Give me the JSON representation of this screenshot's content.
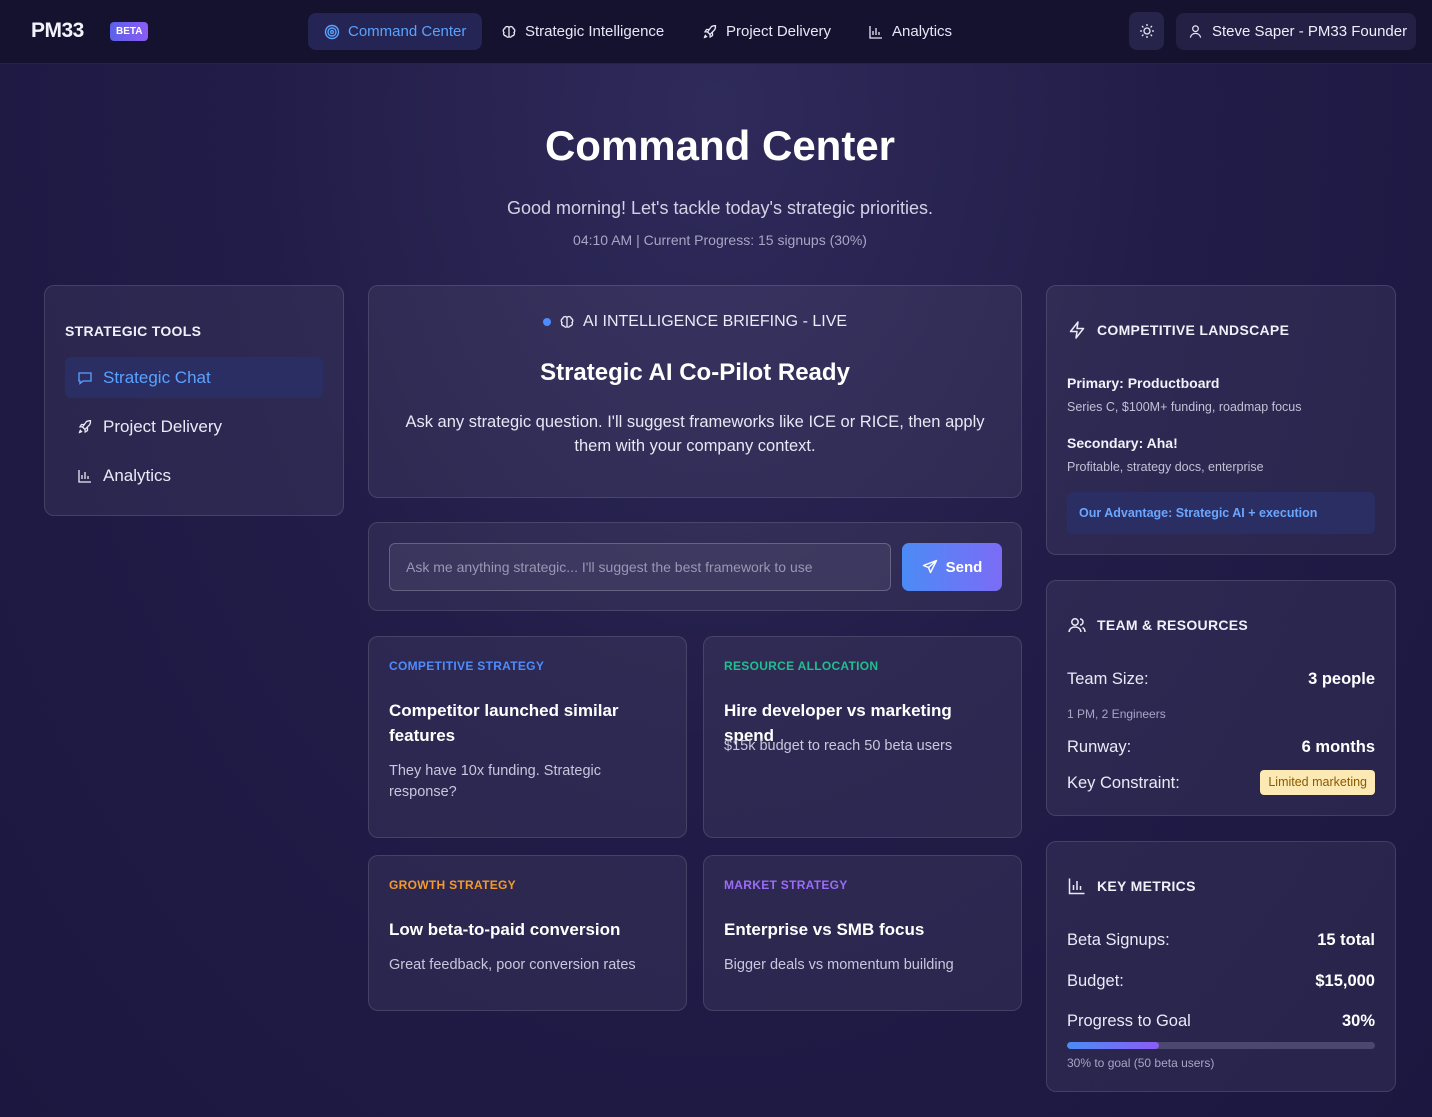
{
  "nav": {
    "logo": "PM33",
    "beta_badge": "BETA",
    "items": [
      {
        "label": "Command Center",
        "icon": "target-icon",
        "active": true
      },
      {
        "label": "Strategic Intelligence",
        "icon": "brain-icon",
        "active": false
      },
      {
        "label": "Project Delivery",
        "icon": "rocket-icon",
        "active": false
      },
      {
        "label": "Analytics",
        "icon": "bar-chart-icon",
        "active": false
      }
    ],
    "theme_icon": "sun-icon",
    "user_label": "Steve Saper - PM33 Founder"
  },
  "hero": {
    "title": "Command Center",
    "subtitle": "Good morning! Let's tackle today's strategic priorities.",
    "meta": "04:10 AM | Current Progress: 15 signups (30%)"
  },
  "tools": {
    "heading": "STRATEGIC TOOLS",
    "items": [
      {
        "label": "Strategic Chat",
        "icon": "chat-icon",
        "active": true
      },
      {
        "label": "Project Delivery",
        "icon": "rocket-icon",
        "active": false
      },
      {
        "label": "Analytics",
        "icon": "bar-chart-icon",
        "active": false
      }
    ]
  },
  "briefing": {
    "label": "AI INTELLIGENCE BRIEFING - LIVE",
    "title": "Strategic AI Co-Pilot Ready",
    "body": "Ask any strategic question. I'll suggest frameworks like ICE or RICE, then apply them with your company context."
  },
  "ask": {
    "placeholder": "Ask me anything strategic... I'll suggest the best framework to use",
    "value": "",
    "send_label": "Send"
  },
  "scenarios": [
    {
      "category": "COMPETITIVE STRATEGY",
      "color": "#4c8cff",
      "title": "Competitor launched similar features",
      "description": "They have 10x funding. Strategic response?"
    },
    {
      "category": "RESOURCE ALLOCATION",
      "color": "#1fbf8f",
      "title": "Hire developer vs marketing spend",
      "description": "$15k budget to reach 50 beta users"
    },
    {
      "category": "GROWTH STRATEGY",
      "color": "#f39a2b",
      "title": "Low beta-to-paid conversion",
      "description": "Great feedback, poor conversion rates"
    },
    {
      "category": "MARKET STRATEGY",
      "color": "#9b6cf6",
      "title": "Enterprise vs SMB focus",
      "description": "Bigger deals vs momentum building"
    }
  ],
  "competitive": {
    "heading": "COMPETITIVE LANDSCAPE",
    "primary_name": "Primary: Productboard",
    "primary_desc": "Series C, $100M+ funding, roadmap focus",
    "secondary_name": "Secondary: Aha!",
    "secondary_desc": "Profitable, strategy docs, enterprise",
    "advantage": "Our Advantage: Strategic AI + execution"
  },
  "team": {
    "heading": "TEAM & RESOURCES",
    "size_label": "Team Size:",
    "size_value": "3 people",
    "size_note": "1 PM, 2 Engineers",
    "runway_label": "Runway:",
    "runway_value": "6 months",
    "constraint_label": "Key Constraint:",
    "constraint_value": "Limited marketing"
  },
  "metrics": {
    "heading": "KEY METRICS",
    "signups_label": "Beta Signups:",
    "signups_value": "15 total",
    "budget_label": "Budget:",
    "budget_value": "$15,000",
    "progress_label": "Progress to Goal",
    "progress_value": "30%",
    "progress_fraction": 0.3,
    "progress_note": "30% to goal (50 beta users)"
  }
}
